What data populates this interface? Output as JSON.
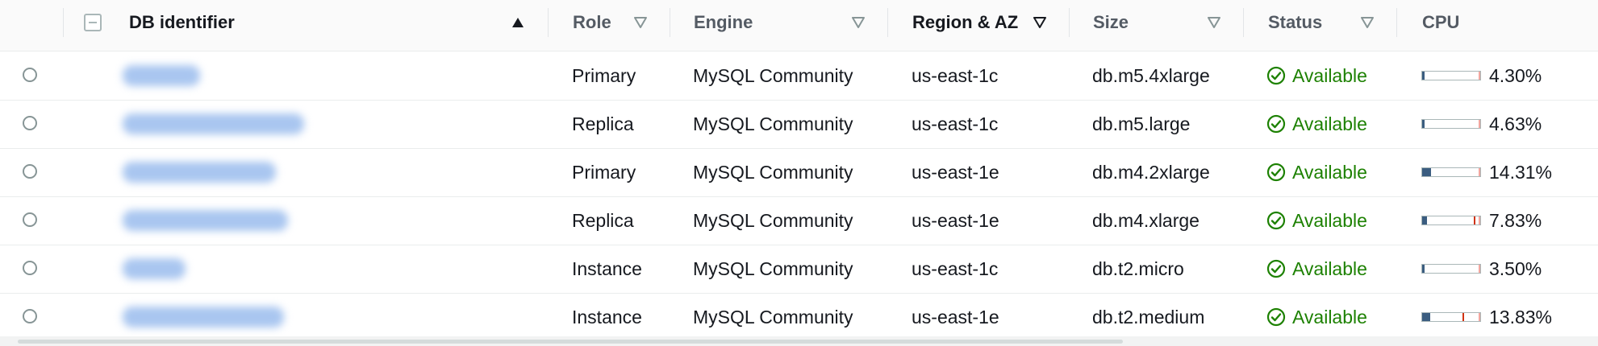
{
  "columns": {
    "db_identifier": "DB identifier",
    "role": "Role",
    "engine": "Engine",
    "region_az": "Region & AZ",
    "size": "Size",
    "status": "Status",
    "cpu": "CPU"
  },
  "sort": {
    "column": "DB identifier",
    "direction": "ascending"
  },
  "colors": {
    "available": "#1d8102",
    "cpu_fill": "#3b5d80",
    "cpu_threshold": "#d13212"
  },
  "rows": [
    {
      "role": "Primary",
      "engine": "MySQL Community",
      "region_az": "us-east-1c",
      "size": "db.m5.4xlarge",
      "status": "Available",
      "cpu": "4.30%",
      "cpu_level": 0.043
    },
    {
      "role": "Replica",
      "engine": "MySQL Community",
      "region_az": "us-east-1c",
      "size": "db.m5.large",
      "status": "Available",
      "cpu": "4.63%",
      "cpu_level": 0.0463
    },
    {
      "role": "Primary",
      "engine": "MySQL Community",
      "region_az": "us-east-1e",
      "size": "db.m4.2xlarge",
      "status": "Available",
      "cpu": "14.31%",
      "cpu_level": 0.1431
    },
    {
      "role": "Replica",
      "engine": "MySQL Community",
      "region_az": "us-east-1e",
      "size": "db.m4.xlarge",
      "status": "Available",
      "cpu": "7.83%",
      "cpu_level": 0.0783
    },
    {
      "role": "Instance",
      "engine": "MySQL Community",
      "region_az": "us-east-1c",
      "size": "db.t2.micro",
      "status": "Available",
      "cpu": "3.50%",
      "cpu_level": 0.035
    },
    {
      "role": "Instance",
      "engine": "MySQL Community",
      "region_az": "us-east-1e",
      "size": "db.t2.medium",
      "status": "Available",
      "cpu": "13.83%",
      "cpu_level": 0.1383
    }
  ]
}
